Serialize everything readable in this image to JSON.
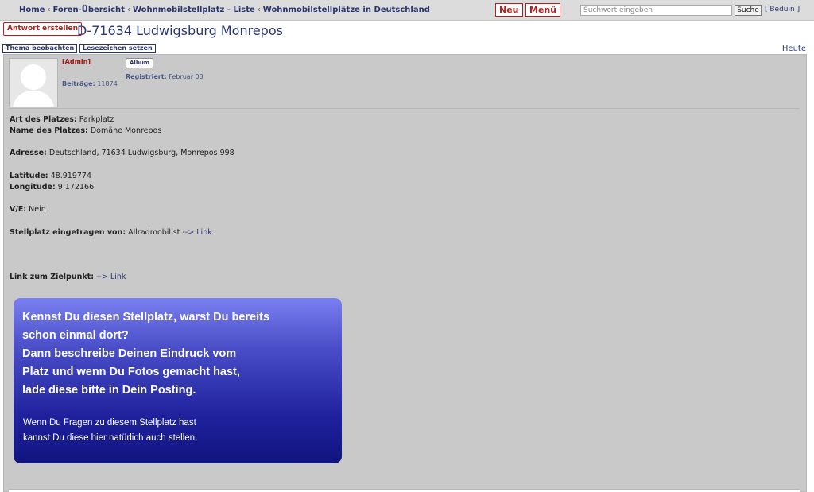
{
  "topbar": {
    "breadcrumbs": [
      "Home",
      "Foren-Übersicht",
      "Wohnmobilstellplatz - Liste",
      "Wohnmobilstellplätze in Deutschland"
    ],
    "separator": "‹",
    "neu_label": "Neu",
    "menu_label": "Menü",
    "search_placeholder": "Suchwort eingeben",
    "search_button": "Suche",
    "user_link": "[ Beduin ]"
  },
  "title_bar": {
    "reply_button": "Antwort erstellen",
    "page_title": "D-71634 Ludwigsburg Monrepos",
    "watch_button": "Thema beobachten",
    "bookmark_button": "Lesezeichen setzen",
    "date_label": "Heute"
  },
  "post": {
    "author": {
      "role": "[Admin]",
      "dash": "-",
      "posts_label": "Beiträge:",
      "posts_value": "11874",
      "album_button": "Album",
      "registered_label": "Registriert:",
      "registered_value": "Februar 03"
    },
    "fields": {
      "art_label": "Art des Platzes:",
      "art_value": "Parkplatz",
      "name_label": "Name des Platzes:",
      "name_value": "Domäne Monrepos",
      "address_label": "Adresse:",
      "address_value": "Deutschland, 71634 Ludwigsburg, Monrepos 998",
      "latitude_label": "Latitude:",
      "latitude_value": "48.919774",
      "longitude_label": "Longitude:",
      "longitude_value": "9.172166",
      "ve_label": "V/E:",
      "ve_value": "Nein",
      "entered_label": "Stellplatz eingetragen von:",
      "entered_value": "Allradmobilist",
      "entered_link": "--> Link",
      "target_label": "Link zum Zielpunkt:",
      "target_link": "--> Link"
    },
    "info_box": {
      "main_lines": [
        "Kennst Du diesen Stellplatz, warst Du bereits",
        "schon einmal dort?",
        "Dann beschreibe Deinen Eindruck vom",
        "Platz und wenn Du Fotos gemacht hast,",
        "lade diese bitte in Dein Posting."
      ],
      "sub_lines": [
        "Wenn Du Fragen zu diesem Stellplatz hast",
        "kannst Du diese hier natürlich auch stellen."
      ]
    }
  },
  "colors": {
    "nav_text": "#2a3570",
    "accent_red": "#b32020",
    "post_bg": "#c9c9c9",
    "info_gradient_top": "#7a80f0",
    "info_gradient_bottom": "#10147e"
  }
}
